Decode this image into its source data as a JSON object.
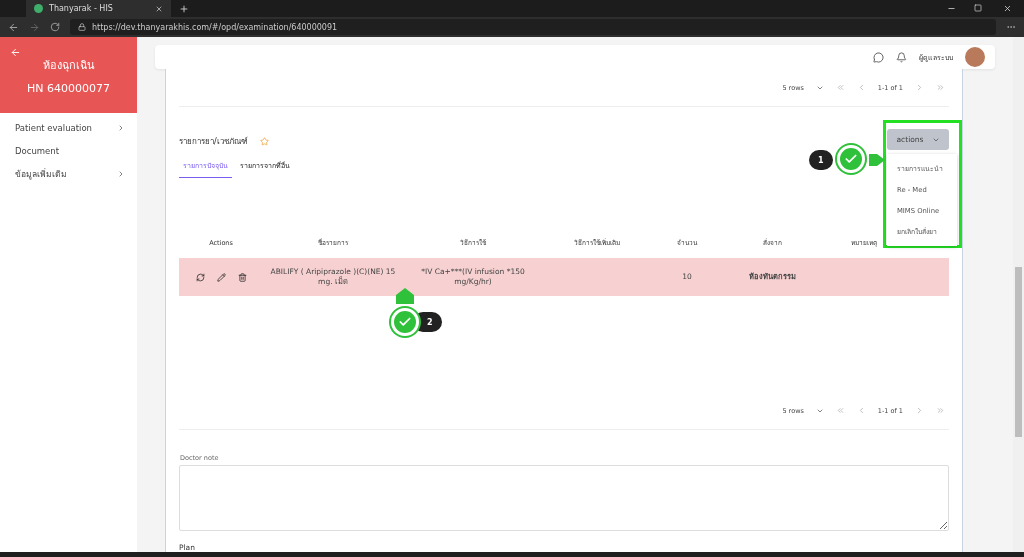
{
  "browser": {
    "tab_title": "Thanyarak - HIS",
    "url": "https://dev.thanyarakhis.com/#/opd/examination/640000091"
  },
  "sidebar": {
    "department": "ห้องฉุกเฉิน",
    "hn": "HN 640000077",
    "items": [
      {
        "label": "Patient evaluation",
        "expandable": true
      },
      {
        "label": "Document",
        "expandable": false
      },
      {
        "label": "ข้อมูลเพิ่มเติม",
        "expandable": true
      }
    ]
  },
  "topbar": {
    "user": "ผู้ดูแลระบบ"
  },
  "top_pagination": {
    "rows": "5 rows",
    "range": "1-1 of 1"
  },
  "section": {
    "title": "รายการยา/เวชภัณฑ์"
  },
  "tabs": [
    {
      "label": "รายการปัจจุบัน",
      "selected": true
    },
    {
      "label": "รายการจากที่อื่น",
      "selected": false
    }
  ],
  "actions": {
    "label": "actions",
    "menu": [
      "รายการแนะนำ",
      "Re - Med",
      "MIMS Online",
      "ยกเลิกใบสั่งยา"
    ]
  },
  "table": {
    "columns": [
      "Actions",
      "ชื่อรายการ",
      "วิธีการใช้",
      "วิธีการใช้เพิ่มเติม",
      "จำนวน",
      "สั่งจาก",
      "หมายเหตุ"
    ],
    "rows": [
      {
        "selected": true,
        "name": "ABILIFY ( Aripiprazole )(C)(NE) 15 mg. เม็ด",
        "usage": "*IV Ca+***(IV infusion *150 mg/Kg/hr)",
        "quantity": "10",
        "ordered_from": "ห้องทันตกรรม"
      }
    ]
  },
  "bottom_pagination": {
    "rows": "5 rows",
    "range": "1-1 of 1"
  },
  "doctor_note": {
    "label": "Doctor note"
  },
  "plan": {
    "label": "Plan"
  },
  "callouts": [
    {
      "number": "1",
      "kind": "right"
    },
    {
      "number": "2",
      "kind": "up"
    }
  ]
}
